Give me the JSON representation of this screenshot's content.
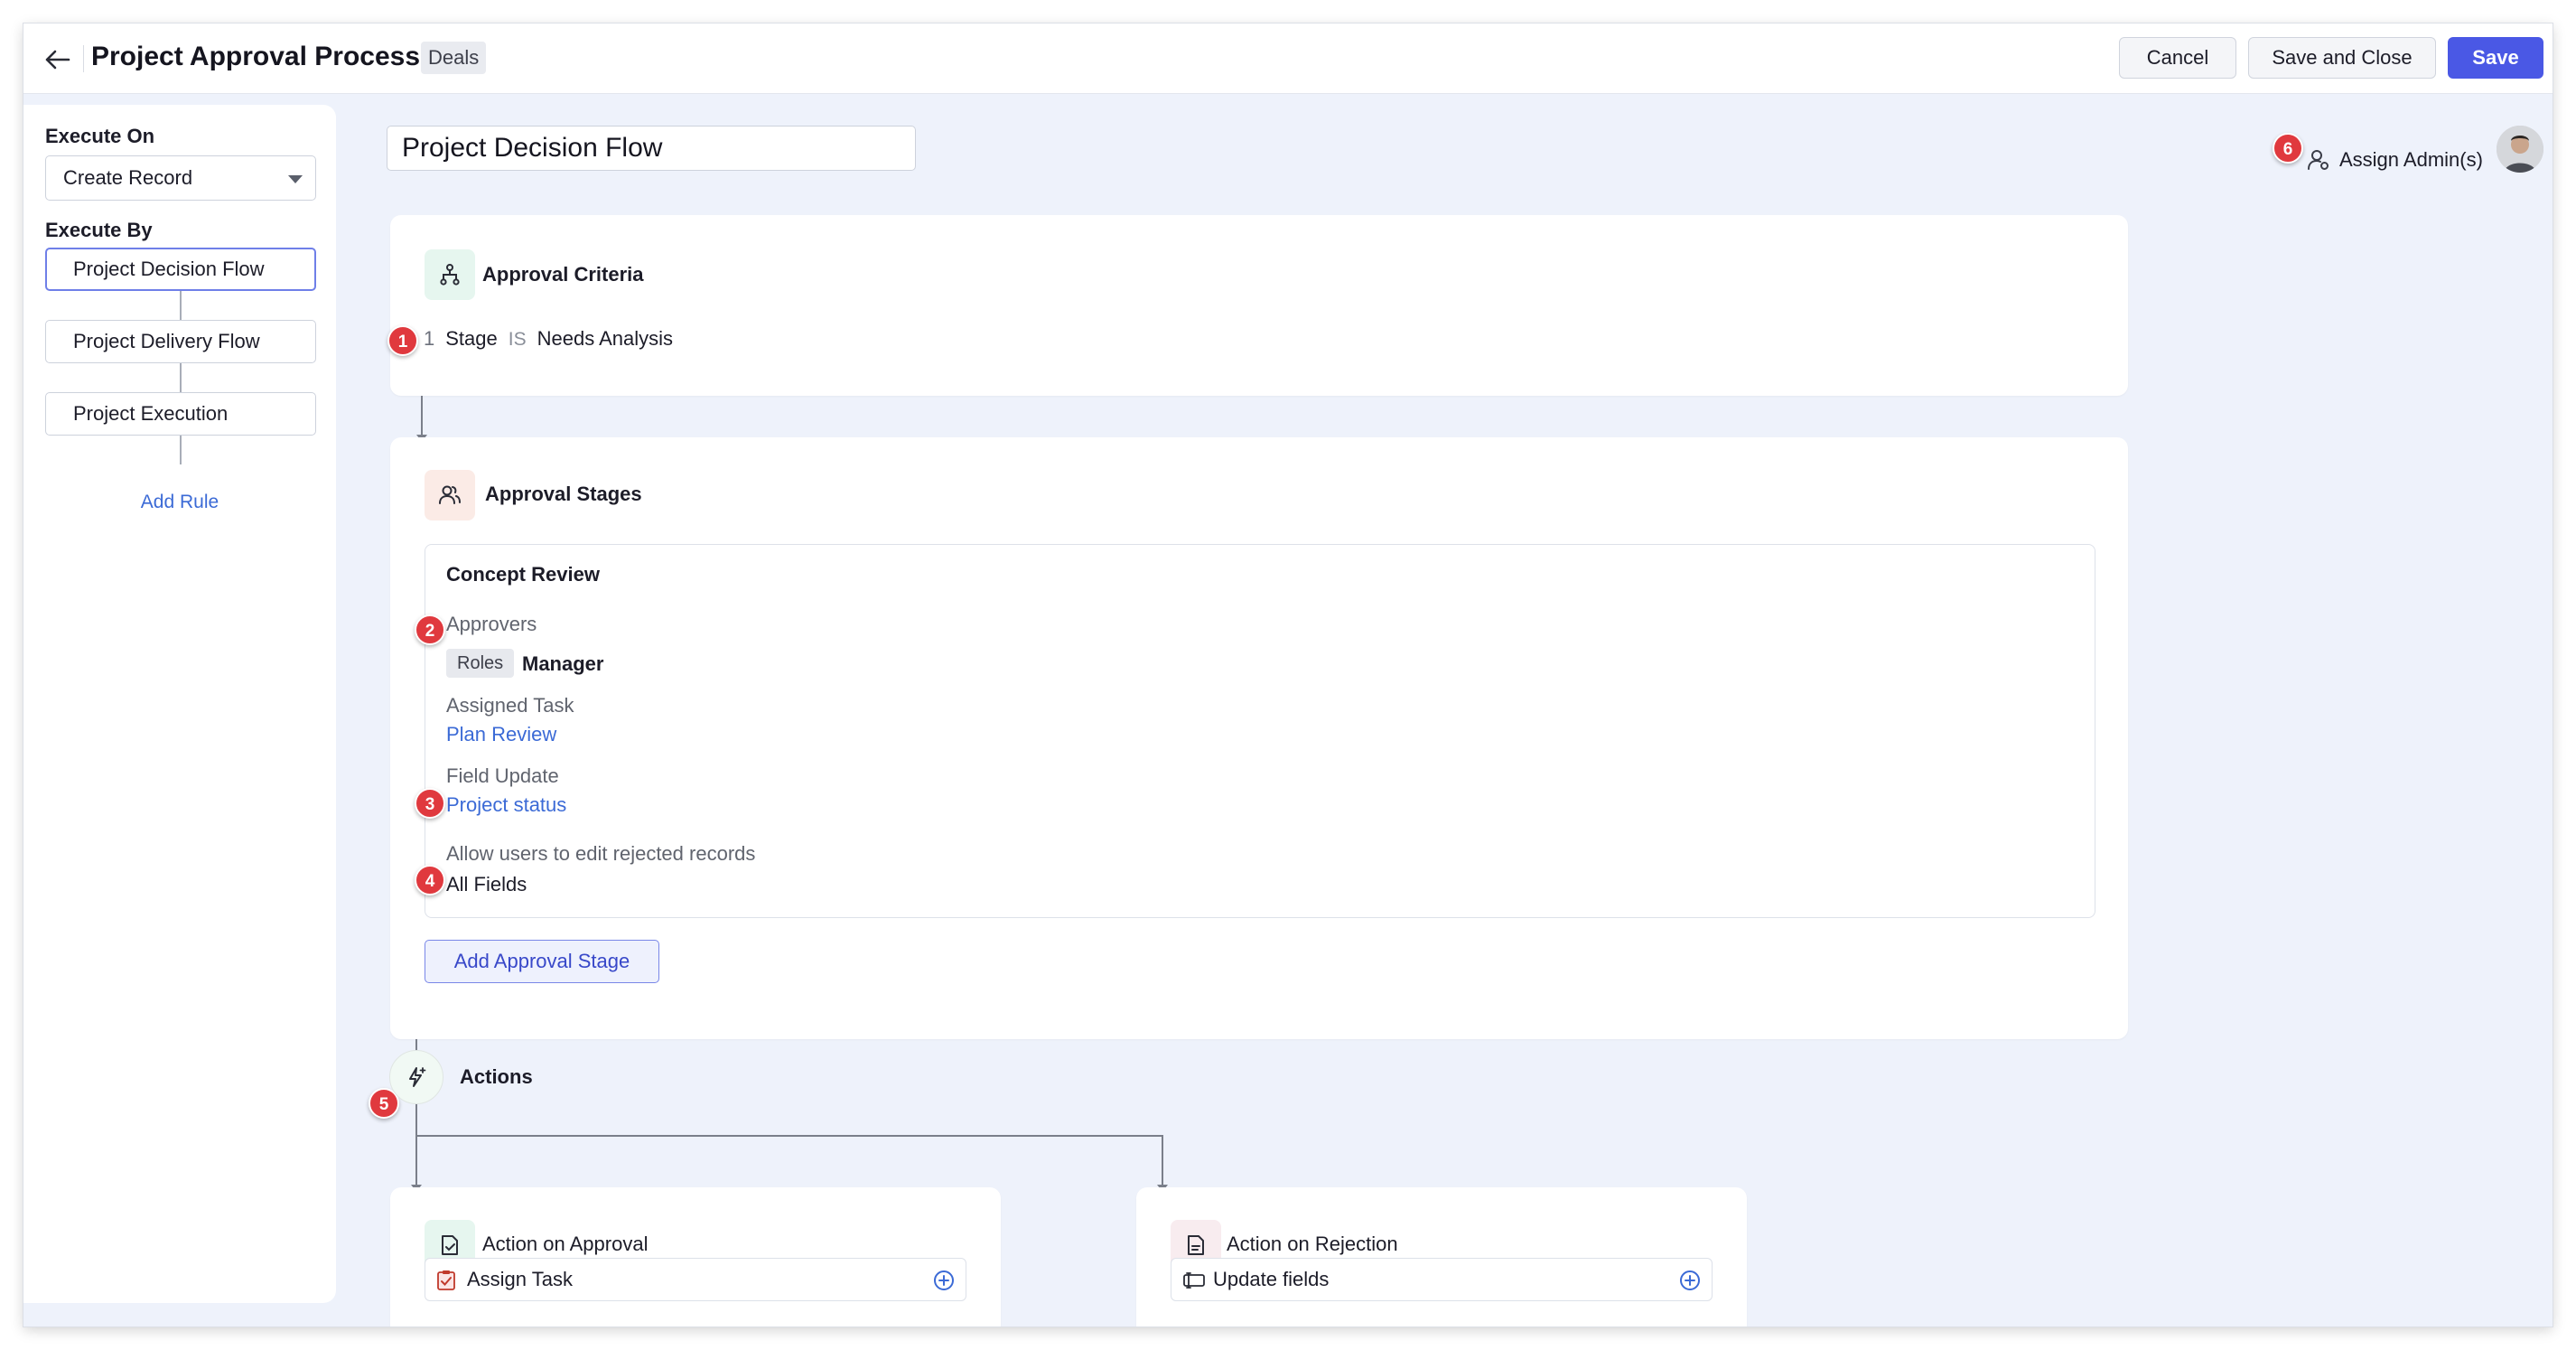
{
  "header": {
    "title": "Project Approval Process",
    "module": "Deals",
    "cancel_label": "Cancel",
    "save_close_label": "Save and Close",
    "save_label": "Save"
  },
  "sidebar": {
    "execute_on_label": "Execute On",
    "execute_on_value": "Create Record",
    "execute_by_label": "Execute By",
    "rules": [
      {
        "label": "Project Decision Flow",
        "active": true
      },
      {
        "label": "Project Delivery Flow",
        "active": false
      },
      {
        "label": "Project Execution",
        "active": false
      }
    ],
    "add_rule_label": "Add Rule"
  },
  "main": {
    "flow_name": "Project Decision Flow",
    "assign_admin_label": "Assign Admin(s)",
    "criteria": {
      "title": "Approval Criteria",
      "rows": [
        {
          "num": "1",
          "field": "Stage",
          "operator": "IS",
          "value": "Needs Analysis"
        }
      ]
    },
    "stages": {
      "title": "Approval Stages",
      "stage": {
        "title": "Concept Review",
        "approvers_label": "Approvers",
        "approver_type": "Roles",
        "approver_value": "Manager",
        "assigned_task_label": "Assigned Task",
        "assigned_task_value": "Plan Review",
        "field_update_label": "Field Update",
        "field_update_value": "Project status",
        "edit_rejected_label": "Allow users to edit rejected records",
        "edit_rejected_value": "All Fields"
      },
      "add_stage_label": "Add Approval Stage"
    },
    "actions": {
      "title": "Actions",
      "approval": {
        "title": "Action on Approval",
        "item": "Assign Task"
      },
      "rejection": {
        "title": "Action on Rejection",
        "item": "Update fields"
      }
    },
    "callouts": [
      "1",
      "2",
      "3",
      "4",
      "5",
      "6"
    ]
  },
  "colors": {
    "primary": "#4a58e5",
    "link": "#3b6ad6",
    "callout": "#e0393e",
    "canvas": "#eef2fb"
  }
}
